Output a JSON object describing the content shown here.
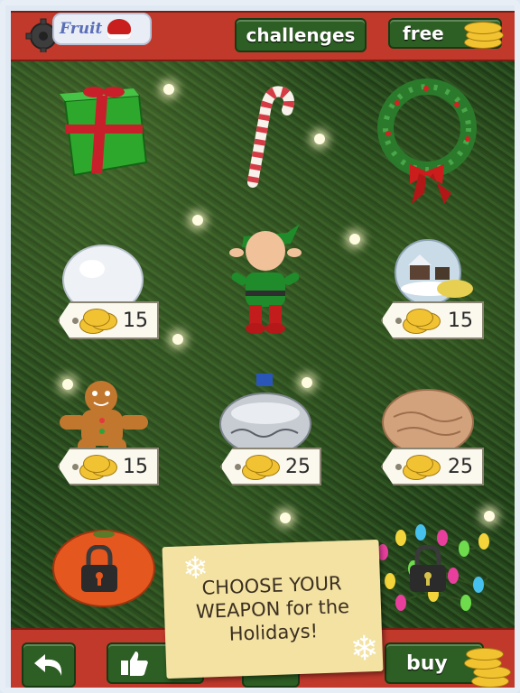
{
  "logo": {
    "text": "Fruit"
  },
  "header": {
    "challenges_label": "challenges",
    "free_label": "free"
  },
  "items": [
    {
      "name": "gift",
      "price": ""
    },
    {
      "name": "candy-cane",
      "price": ""
    },
    {
      "name": "wreath",
      "price": ""
    },
    {
      "name": "snowball",
      "price": "15"
    },
    {
      "name": "elf",
      "price": ""
    },
    {
      "name": "snow-globe",
      "price": "15"
    },
    {
      "name": "gingerbread",
      "price": "15"
    },
    {
      "name": "ornament",
      "price": "25"
    },
    {
      "name": "walnut",
      "price": "25"
    },
    {
      "name": "tangerine",
      "locked": true
    },
    {
      "name": "string-lights",
      "locked": true
    }
  ],
  "prices": {
    "snowball": "15",
    "snowglobe": "15",
    "gingerbread": "15",
    "ornament": "25",
    "walnut": "25"
  },
  "note": {
    "line1": "CHOOSE YOUR",
    "line2": "WEAPON for the",
    "line3": "Holidays!"
  },
  "footer": {
    "buy_label": "buy"
  },
  "colors": {
    "bar_red": "#c0392b",
    "button_green": "#2d5e23",
    "coin_gold": "#f2c331"
  }
}
